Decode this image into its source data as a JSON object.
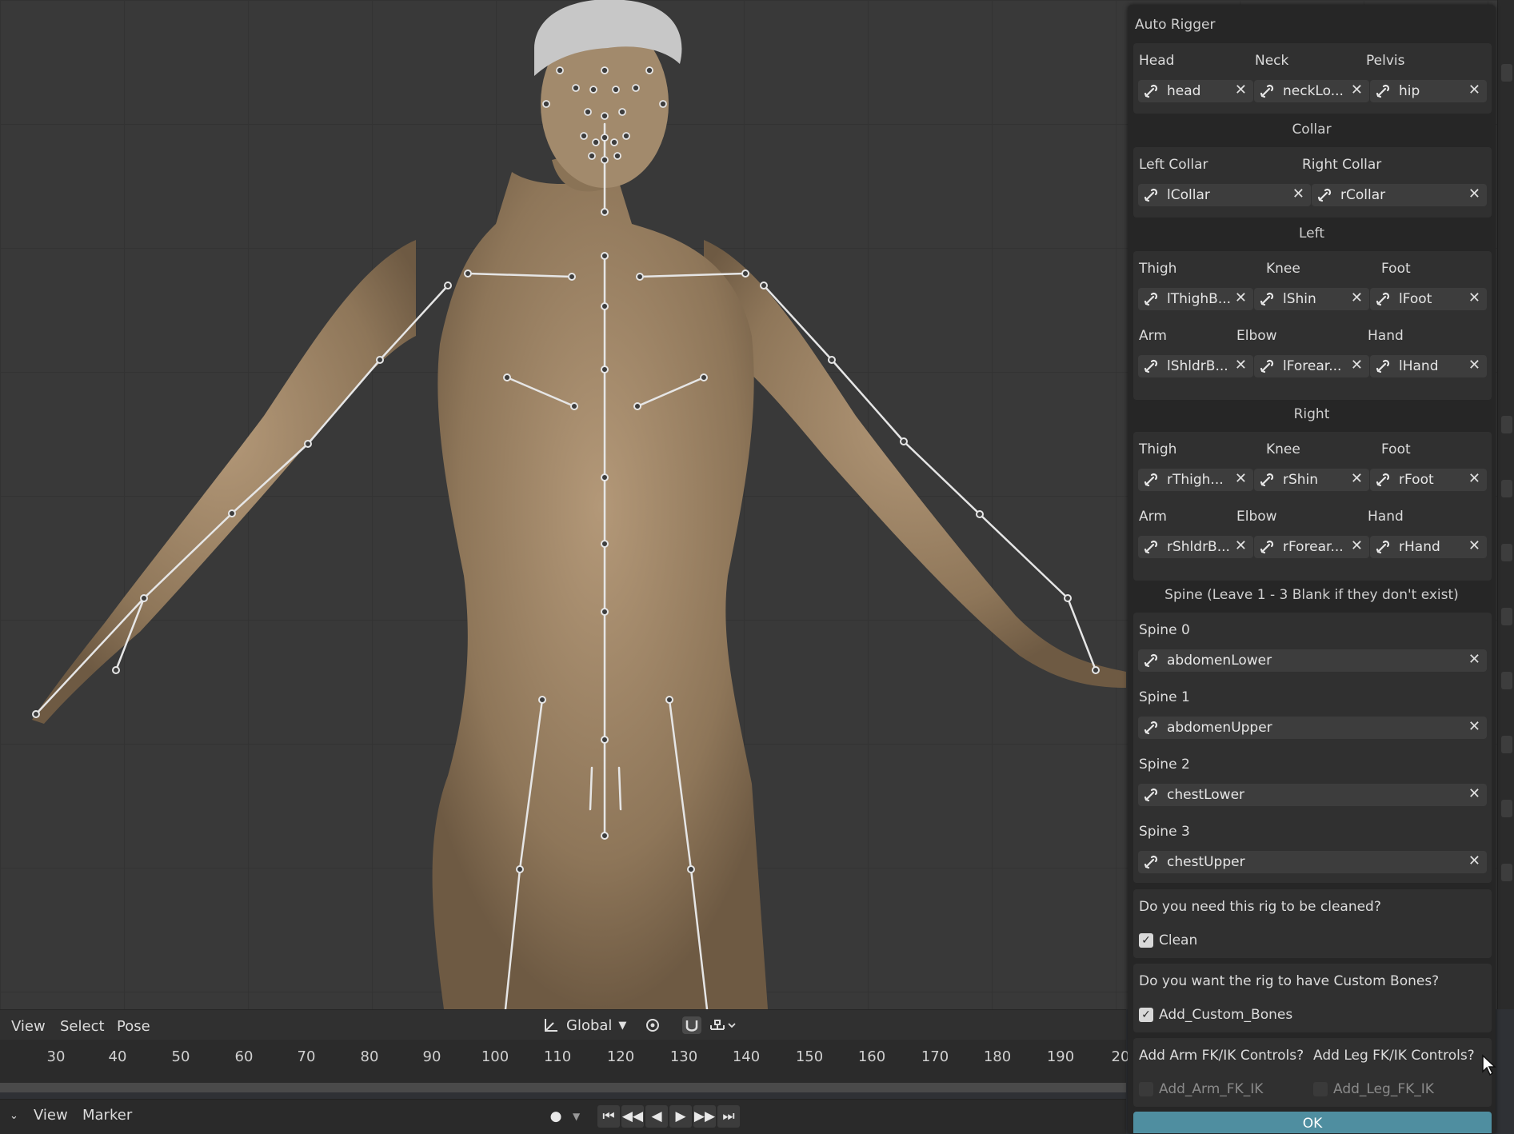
{
  "panel": {
    "title": "Auto Rigger",
    "head_row": {
      "labels": [
        "Head",
        "Neck",
        "Pelvis"
      ],
      "values": [
        "head",
        "neckLo...",
        "hip"
      ]
    },
    "collar": {
      "section": "Collar",
      "labels": [
        "Left Collar",
        "Right Collar"
      ],
      "values": [
        "lCollar",
        "rCollar"
      ]
    },
    "left": {
      "section": "Left",
      "leg_labels": [
        "Thigh",
        "Knee",
        "Foot"
      ],
      "leg_values": [
        "lThighB...",
        "lShin",
        "lFoot"
      ],
      "arm_labels": [
        "Arm",
        "Elbow",
        "Hand"
      ],
      "arm_values": [
        "lShldrB...",
        "lForear...",
        "lHand"
      ]
    },
    "right": {
      "section": "Right",
      "leg_labels": [
        "Thigh",
        "Knee",
        "Foot"
      ],
      "leg_values": [
        "rThigh...",
        "rShin",
        "rFoot"
      ],
      "arm_labels": [
        "Arm",
        "Elbow",
        "Hand"
      ],
      "arm_values": [
        "rShldrB...",
        "rForear...",
        "rHand"
      ]
    },
    "spine": {
      "section": "Spine (Leave 1 - 3 Blank if they don't exist)",
      "labels": [
        "Spine 0",
        "Spine 1",
        "Spine 2",
        "Spine 3"
      ],
      "values": [
        "abdomenLower",
        "abdomenUpper",
        "chestLower",
        "chestUpper"
      ]
    },
    "clean": {
      "question": "Do you need this rig to be cleaned?",
      "label": "Clean",
      "checked": true
    },
    "custom_bones": {
      "question": "Do you want the rig to have Custom Bones?",
      "label": "Add_Custom_Bones",
      "checked": true
    },
    "fkik": {
      "arm_question": "Add Arm FK/IK Controls?",
      "leg_question": "Add Leg FK/IK Controls?",
      "arm_label": "Add_Arm_FK_IK",
      "leg_label": "Add_Leg_FK_IK",
      "arm_checked": false,
      "leg_checked": false
    },
    "ok_label": "OK"
  },
  "header": {
    "menus": [
      "View",
      "Select",
      "Pose"
    ],
    "orientation": "Global"
  },
  "timeline": {
    "ticks": [
      "30",
      "40",
      "50",
      "60",
      "70",
      "80",
      "90",
      "100",
      "110",
      "120",
      "130",
      "140",
      "150",
      "160",
      "170",
      "180",
      "190",
      "20"
    ],
    "menus": [
      "View",
      "Marker"
    ]
  },
  "colors": {
    "panel_bg": "#262626",
    "box_bg": "#303030",
    "field_bg": "#3d3d3d",
    "ok_accent": "#4f8ea0",
    "skin": "#9c8466",
    "bone": "#e6e6e6"
  }
}
